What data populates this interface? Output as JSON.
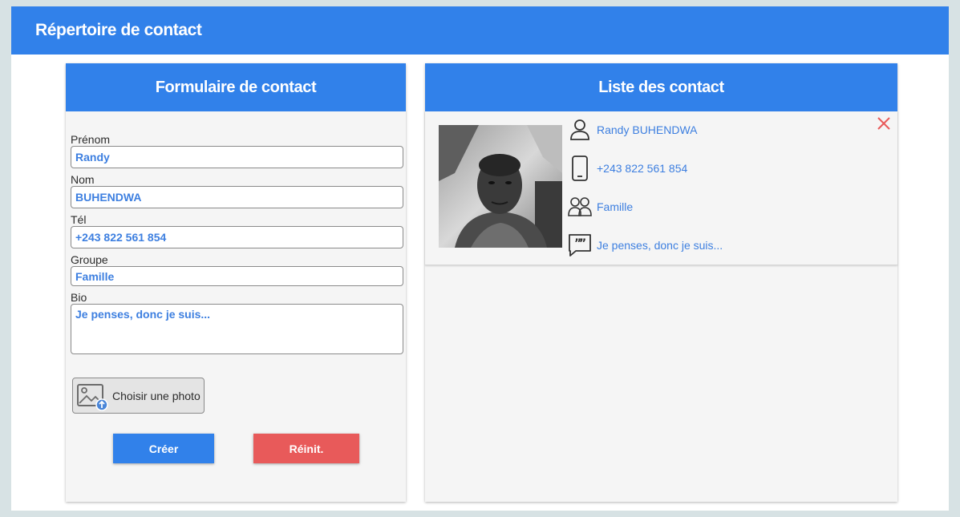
{
  "app": {
    "title": "Répertoire de contact"
  },
  "form": {
    "title": "Formulaire de contact",
    "fields": {
      "prenom": {
        "label": "Prénom",
        "value": "Randy"
      },
      "nom": {
        "label": "Nom",
        "value": "BUHENDWA"
      },
      "tel": {
        "label": "Tél",
        "value": "+243 822 561 854"
      },
      "groupe": {
        "label": "Groupe",
        "value": "Famille"
      },
      "bio": {
        "label": "Bio",
        "value": "Je penses, donc je suis..."
      }
    },
    "photo_button": {
      "label": "Choisir une photo",
      "icon": "image-upload-icon"
    },
    "create_label": "Créer",
    "reset_label": "Réinit."
  },
  "list": {
    "title": "Liste des contact",
    "contacts": [
      {
        "name": "Randy BUHENDWA",
        "phone": "+243 822 561 854",
        "group": "Famille",
        "bio": "Je penses, donc je suis..."
      }
    ]
  },
  "colors": {
    "primary": "#3181ea",
    "danger": "#e85a5a",
    "value_text": "#3d7fe0"
  }
}
